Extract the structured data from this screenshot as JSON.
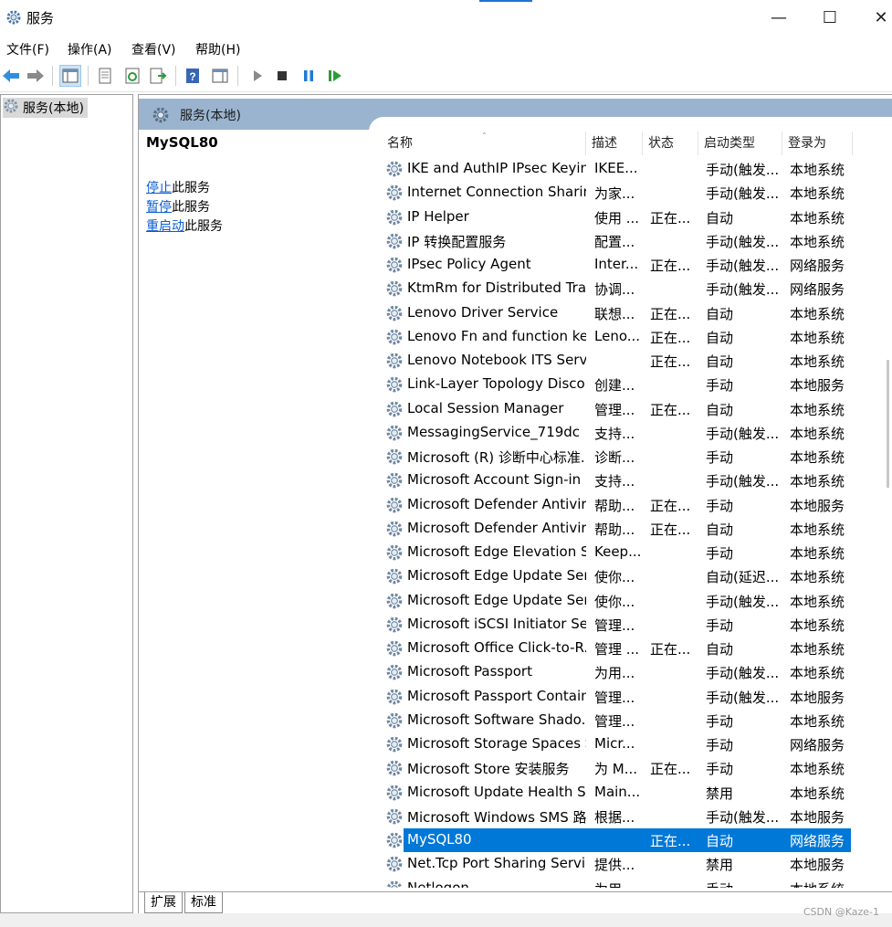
{
  "window": {
    "title": "服务",
    "minimize": "—",
    "maximize": "☐",
    "close": "✕"
  },
  "menu": [
    "文件(F)",
    "操作(A)",
    "查看(V)",
    "帮助(H)"
  ],
  "tree": {
    "root": "服务(本地)"
  },
  "header": {
    "title": "服务(本地)"
  },
  "details": {
    "service_name": "MySQL80",
    "actions": [
      {
        "link": "停止",
        "rest": "此服务"
      },
      {
        "link": "暂停",
        "rest": "此服务"
      },
      {
        "link": "重启动",
        "rest": "此服务"
      }
    ]
  },
  "columns": [
    "名称",
    "描述",
    "状态",
    "启动类型",
    "登录为"
  ],
  "rows": [
    [
      "IKE and AuthIP IPsec Keyin...",
      "IKEE...",
      "",
      "手动(触发...",
      "本地系统"
    ],
    [
      "Internet Connection Sharin...",
      "为家...",
      "",
      "手动(触发...",
      "本地系统"
    ],
    [
      "IP Helper",
      "使用 ...",
      "正在...",
      "自动",
      "本地系统"
    ],
    [
      "IP 转换配置服务",
      "配置...",
      "",
      "手动(触发...",
      "本地系统"
    ],
    [
      "IPsec Policy Agent",
      "Inter...",
      "正在...",
      "手动(触发...",
      "网络服务"
    ],
    [
      "KtmRm for Distributed Tra...",
      "协调...",
      "",
      "手动(触发...",
      "网络服务"
    ],
    [
      "Lenovo Driver Service",
      "联想...",
      "正在...",
      "自动",
      "本地系统"
    ],
    [
      "Lenovo Fn and function ke...",
      "Leno...",
      "正在...",
      "自动",
      "本地系统"
    ],
    [
      "Lenovo Notebook ITS Serv...",
      "",
      "正在...",
      "自动",
      "本地系统"
    ],
    [
      "Link-Layer Topology Disco...",
      "创建...",
      "",
      "手动",
      "本地服务"
    ],
    [
      "Local Session Manager",
      "管理...",
      "正在...",
      "自动",
      "本地系统"
    ],
    [
      "MessagingService_719dc",
      "支持...",
      "",
      "手动(触发...",
      "本地系统"
    ],
    [
      "Microsoft (R) 诊断中心标准...",
      "诊断...",
      "",
      "手动",
      "本地系统"
    ],
    [
      "Microsoft Account Sign-in ...",
      "支持...",
      "",
      "手动(触发...",
      "本地系统"
    ],
    [
      "Microsoft Defender Antivir...",
      "帮助...",
      "正在...",
      "手动",
      "本地服务"
    ],
    [
      "Microsoft Defender Antivir...",
      "帮助...",
      "正在...",
      "自动",
      "本地系统"
    ],
    [
      "Microsoft Edge Elevation S...",
      "Keep...",
      "",
      "手动",
      "本地系统"
    ],
    [
      "Microsoft Edge Update Ser...",
      "使你...",
      "",
      "自动(延迟...",
      "本地系统"
    ],
    [
      "Microsoft Edge Update Ser...",
      "使你...",
      "",
      "手动(触发...",
      "本地系统"
    ],
    [
      "Microsoft iSCSI Initiator Ser...",
      "管理...",
      "",
      "手动",
      "本地系统"
    ],
    [
      "Microsoft Office Click-to-R...",
      "管理 ...",
      "正在...",
      "自动",
      "本地系统"
    ],
    [
      "Microsoft Passport",
      "为用...",
      "",
      "手动(触发...",
      "本地系统"
    ],
    [
      "Microsoft Passport Container",
      "管理...",
      "",
      "手动(触发...",
      "本地服务"
    ],
    [
      "Microsoft Software Shado...",
      "管理...",
      "",
      "手动",
      "本地系统"
    ],
    [
      "Microsoft Storage Spaces S...",
      "Micr...",
      "",
      "手动",
      "网络服务"
    ],
    [
      "Microsoft Store 安装服务",
      "为 M...",
      "正在...",
      "手动",
      "本地系统"
    ],
    [
      "Microsoft Update Health S...",
      "Main...",
      "",
      "禁用",
      "本地系统"
    ],
    [
      "Microsoft Windows SMS 路...",
      "根据...",
      "",
      "手动(触发...",
      "本地服务"
    ],
    [
      "MySQL80",
      "",
      "正在...",
      "自动",
      "网络服务"
    ],
    [
      "Net.Tcp Port Sharing Service",
      "提供...",
      "",
      "禁用",
      "本地服务"
    ],
    [
      "Netlogon",
      "为用...",
      "",
      "手动",
      "本地系统"
    ]
  ],
  "selected_index": 28,
  "tabs": [
    "扩展",
    "标准"
  ],
  "watermark": "CSDN @Kaze-1",
  "colors": {
    "selection": "#0078d7",
    "header_band": "#9ab4cf",
    "link": "#0b5bd3"
  }
}
